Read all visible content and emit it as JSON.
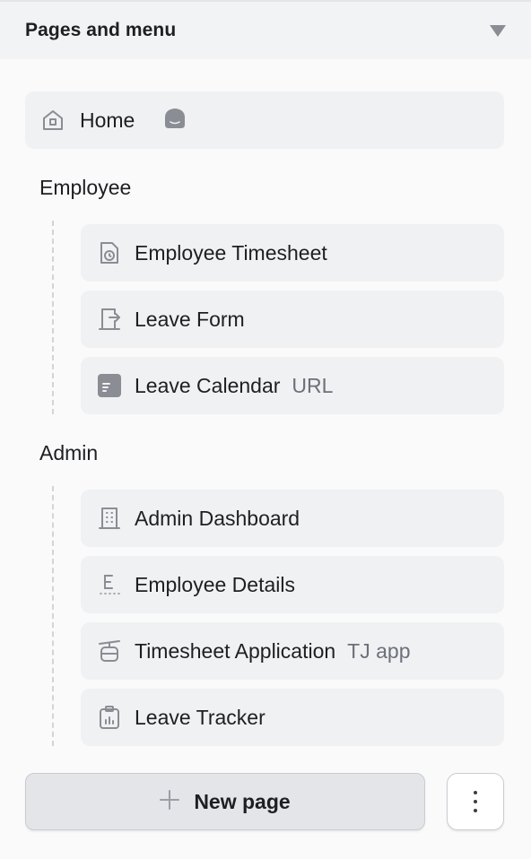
{
  "panel": {
    "title": "Pages and menu",
    "collapse_icon": "triangle-down-icon"
  },
  "home": {
    "label": "Home",
    "icon": "home-icon",
    "badge_icon": "home-badge-icon"
  },
  "groups": [
    {
      "label": "Employee",
      "items": [
        {
          "label": "Employee Timesheet",
          "icon": "clock-document-icon",
          "tag": ""
        },
        {
          "label": "Leave Form",
          "icon": "exit-door-icon",
          "tag": ""
        },
        {
          "label": "Leave Calendar",
          "icon": "url-page-icon",
          "tag": "URL"
        }
      ]
    },
    {
      "label": "Admin",
      "items": [
        {
          "label": "Admin Dashboard",
          "icon": "building-icon",
          "tag": ""
        },
        {
          "label": "Employee Details",
          "icon": "letter-e-icon",
          "tag": ""
        },
        {
          "label": "Timesheet Application",
          "icon": "cable-car-icon",
          "tag": "TJ app"
        },
        {
          "label": "Leave Tracker",
          "icon": "clipboard-chart-icon",
          "tag": ""
        }
      ]
    }
  ],
  "footer": {
    "new_page_label": "New page",
    "new_page_icon": "plus-icon",
    "more_icon": "more-vertical-icon"
  },
  "colors": {
    "header_bg": "#f2f3f5",
    "item_bg": "#f0f1f3",
    "icon_gray": "#8a8d93",
    "tag_gray": "#6c7079",
    "button_bg": "#e3e5e8"
  }
}
